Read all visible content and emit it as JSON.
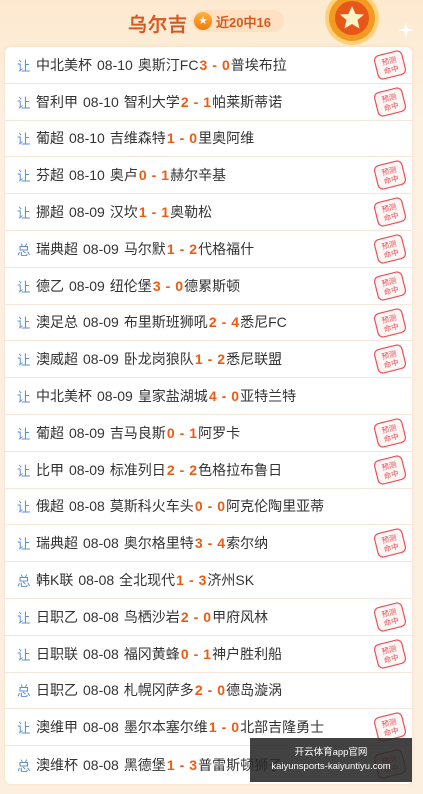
{
  "header": {
    "title": "乌尔吉",
    "record": "近20中16"
  },
  "stamp_text": "预测命中",
  "matches": [
    {
      "kind": "让",
      "league": "中北美杯",
      "date": "08-10",
      "home": "奥斯汀FC",
      "home_score": "3",
      "away_score": "0",
      "away": "普埃布拉",
      "hit": true
    },
    {
      "kind": "让",
      "league": "智利甲",
      "date": "08-10",
      "home": "智利大学",
      "home_score": "2",
      "away_score": "1",
      "away": "帕莱斯蒂诺",
      "hit": true
    },
    {
      "kind": "让",
      "league": "葡超",
      "date": "08-10",
      "home": "吉维森特",
      "home_score": "1",
      "away_score": "0",
      "away": "里奥阿维",
      "hit": false
    },
    {
      "kind": "让",
      "league": "芬超",
      "date": "08-10",
      "home": "奥卢",
      "home_score": "0",
      "away_score": "1",
      "away": "赫尔辛基",
      "hit": true
    },
    {
      "kind": "让",
      "league": "挪超",
      "date": "08-09",
      "home": "汉坎",
      "home_score": "1",
      "away_score": "1",
      "away": "奥勒松",
      "hit": true
    },
    {
      "kind": "总",
      "league": "瑞典超",
      "date": "08-09",
      "home": "马尔默",
      "home_score": "1",
      "away_score": "2",
      "away": "代格福什",
      "hit": true
    },
    {
      "kind": "让",
      "league": "德乙",
      "date": "08-09",
      "home": "纽伦堡",
      "home_score": "3",
      "away_score": "0",
      "away": "德累斯顿",
      "hit": true
    },
    {
      "kind": "让",
      "league": "澳足总",
      "date": "08-09",
      "home": "布里斯班狮吼",
      "home_score": "2",
      "away_score": "4",
      "away": "悉尼FC",
      "hit": true
    },
    {
      "kind": "让",
      "league": "澳威超",
      "date": "08-09",
      "home": "卧龙岗狼队",
      "home_score": "1",
      "away_score": "2",
      "away": "悉尼联盟",
      "hit": true
    },
    {
      "kind": "让",
      "league": "中北美杯",
      "date": "08-09",
      "home": "皇家盐湖城",
      "home_score": "4",
      "away_score": "0",
      "away": "亚特兰特",
      "hit": false
    },
    {
      "kind": "让",
      "league": "葡超",
      "date": "08-09",
      "home": "吉马良斯",
      "home_score": "0",
      "away_score": "1",
      "away": "阿罗卡",
      "hit": true
    },
    {
      "kind": "让",
      "league": "比甲",
      "date": "08-09",
      "home": "标准列日",
      "home_score": "2",
      "away_score": "2",
      "away": "色格拉布鲁日",
      "hit": true
    },
    {
      "kind": "让",
      "league": "俄超",
      "date": "08-08",
      "home": "莫斯科火车头",
      "home_score": "0",
      "away_score": "0",
      "away": "阿克伦陶里亚蒂",
      "hit": false
    },
    {
      "kind": "让",
      "league": "瑞典超",
      "date": "08-08",
      "home": "奥尔格里特",
      "home_score": "3",
      "away_score": "4",
      "away": "索尔纳",
      "hit": true
    },
    {
      "kind": "总",
      "league": "韩K联",
      "date": "08-08",
      "home": "全北现代",
      "home_score": "1",
      "away_score": "3",
      "away": "济州SK",
      "hit": false
    },
    {
      "kind": "让",
      "league": "日职乙",
      "date": "08-08",
      "home": "鸟栖沙岩",
      "home_score": "2",
      "away_score": "0",
      "away": "甲府风林",
      "hit": true
    },
    {
      "kind": "让",
      "league": "日职联",
      "date": "08-08",
      "home": "福冈黄蜂",
      "home_score": "0",
      "away_score": "1",
      "away": "神户胜利船",
      "hit": true
    },
    {
      "kind": "总",
      "league": "日职乙",
      "date": "08-08",
      "home": "札幌冈萨多",
      "home_score": "2",
      "away_score": "0",
      "away": "德岛漩涡",
      "hit": false
    },
    {
      "kind": "让",
      "league": "澳维甲",
      "date": "08-08",
      "home": "墨尔本塞尔维",
      "home_score": "1",
      "away_score": "0",
      "away": "北部吉隆勇士",
      "hit": true
    },
    {
      "kind": "总",
      "league": "澳维杯",
      "date": "08-08",
      "home": "黑德堡",
      "home_score": "1",
      "away_score": "3",
      "away": "普雷斯顿狮子",
      "hit": true
    }
  ],
  "overlay": {
    "line1": "开云体育app官网",
    "line2": "kaiyunsports-kaiyuntiyu.com"
  },
  "colors": {
    "accent": "#ef5a13",
    "kind_label": "#5b8fd1",
    "stamp": "#e8525a"
  }
}
